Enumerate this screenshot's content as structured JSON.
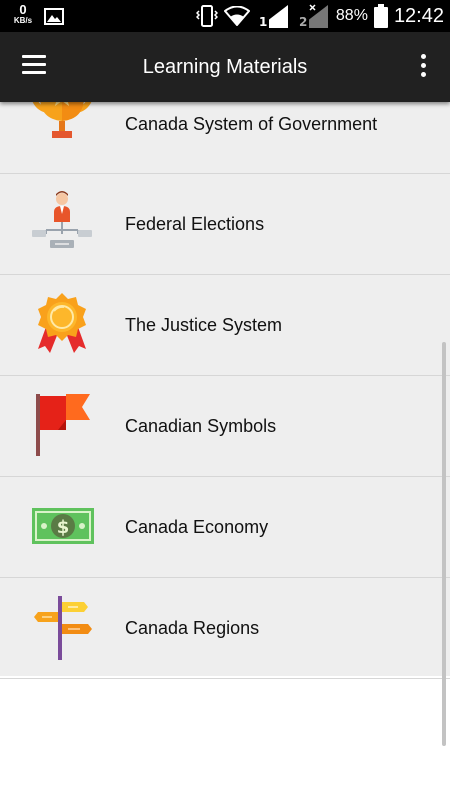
{
  "status_bar": {
    "speed_value": "0",
    "speed_unit": "KB/s",
    "battery_percent": "88%",
    "time": "12:42",
    "icons": [
      "image-icon",
      "vibrate-icon",
      "wifi-icon",
      "signal-sim1-icon",
      "signal-sim2-icon",
      "battery-icon"
    ]
  },
  "appbar": {
    "title": "Learning Materials",
    "menu_icon": "hamburger-menu-icon",
    "overflow_icon": "more-vertical-icon",
    "background": "#212121"
  },
  "list": {
    "background": "#eeeeee",
    "items": [
      {
        "label": "Canada System of Government",
        "icon": "trophy-icon"
      },
      {
        "label": "Federal Elections",
        "icon": "candidate-network-icon"
      },
      {
        "label": "The Justice System",
        "icon": "award-badge-icon"
      },
      {
        "label": "Canadian Symbols",
        "icon": "red-flag-icon"
      },
      {
        "label": "Canada Economy",
        "icon": "dollar-bill-icon"
      },
      {
        "label": "Canada Regions",
        "icon": "signpost-icon"
      }
    ]
  }
}
